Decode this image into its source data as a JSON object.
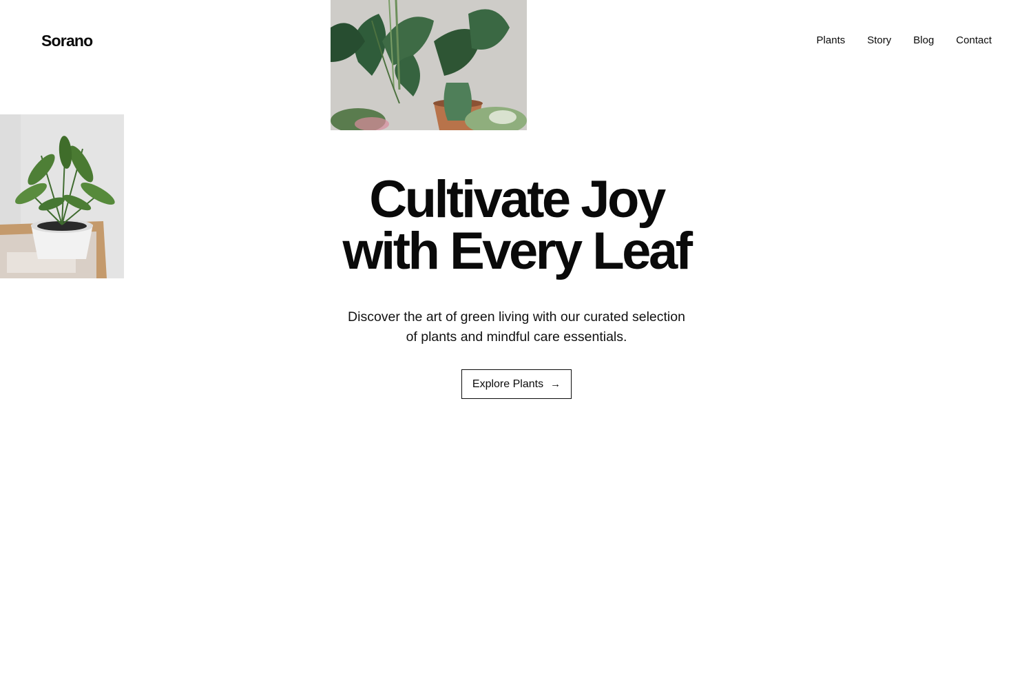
{
  "brand": {
    "name": "Sorano"
  },
  "nav": {
    "items": [
      {
        "label": "Plants"
      },
      {
        "label": "Story"
      },
      {
        "label": "Blog"
      },
      {
        "label": "Contact"
      }
    ]
  },
  "hero": {
    "title_lines": [
      "Cultivate Joy",
      "with Every Leaf"
    ],
    "subtitle_lines": [
      "Discover the art of green living with our curated selection",
      "of plants and mindful care essentials."
    ],
    "cta": {
      "label": "Explore Plants",
      "icon": "arrow-right-icon",
      "icon_glyph": "→"
    }
  },
  "images": {
    "top": {
      "subject": "potted-plants-photo"
    },
    "left": {
      "subject": "palm-in-pot-photo"
    }
  },
  "colors": {
    "text": "#0a0a0a",
    "background": "#ffffff",
    "button_border": "#0a0a0a"
  }
}
